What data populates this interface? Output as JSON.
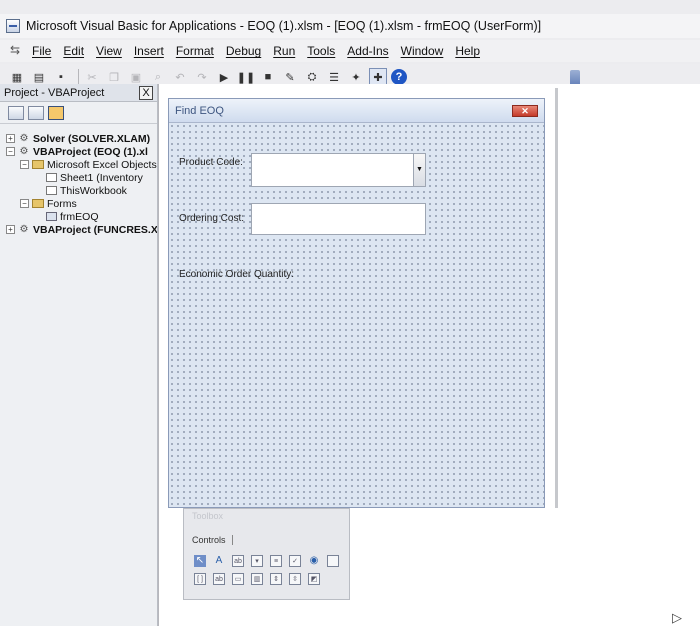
{
  "window": {
    "title": "Microsoft Visual Basic for Applications - EOQ (1).xlsm - [EOQ (1).xlsm - frmEOQ (UserForm)]"
  },
  "menu": [
    "File",
    "Edit",
    "View",
    "Insert",
    "Format",
    "Debug",
    "Run",
    "Tools",
    "Add-Ins",
    "Window",
    "Help"
  ],
  "toolbar": {
    "buttons": [
      "view-excel-icon",
      "insert-userform-icon",
      "save-icon",
      "cut-icon",
      "copy-icon",
      "paste-icon",
      "find-icon",
      "undo-icon",
      "redo-icon",
      "run-icon",
      "break-icon",
      "reset-icon",
      "design-mode-icon",
      "project-explorer-icon",
      "properties-icon",
      "object-browser-icon",
      "toolbox-icon",
      "help-icon"
    ],
    "help_glyph": "?"
  },
  "project": {
    "header": "Project - VBAProject",
    "close_glyph": "X",
    "tree": [
      {
        "label": "Solver (SOLVER.XLAM)",
        "bold": true
      },
      {
        "label": "VBAProject (EOQ (1).xl",
        "bold": true
      },
      {
        "label": "Microsoft Excel Objects",
        "bold": false
      },
      {
        "label": "Sheet1 (Inventory",
        "bold": false
      },
      {
        "label": "ThisWorkbook",
        "bold": false
      },
      {
        "label": "Forms",
        "bold": false
      },
      {
        "label": "frmEOQ",
        "bold": false
      },
      {
        "label": "VBAProject (FUNCRES.X",
        "bold": true
      }
    ]
  },
  "userform": {
    "caption": "Find EOQ",
    "close_glyph": "✕",
    "product_code_label": "Product Code:",
    "ordering_cost_label": "Ordering Cost:",
    "eoq_label": "Economic Order Quantity:",
    "combo_arrow": "▼"
  },
  "toolbox": {
    "title": "Toolbox",
    "tab": "Controls",
    "row1": [
      "select-objects-icon",
      "label-icon",
      "textbox-icon",
      "combobox-icon",
      "listbox-icon",
      "checkbox-icon",
      "optionbutton-icon",
      "togglebutton-icon"
    ],
    "row2": [
      "frame-icon",
      "commandbutton-icon",
      "tabstrip-icon",
      "multipage-icon",
      "scrollbar-icon",
      "spinbutton-icon",
      "image-icon"
    ],
    "label_glyph": "A"
  }
}
